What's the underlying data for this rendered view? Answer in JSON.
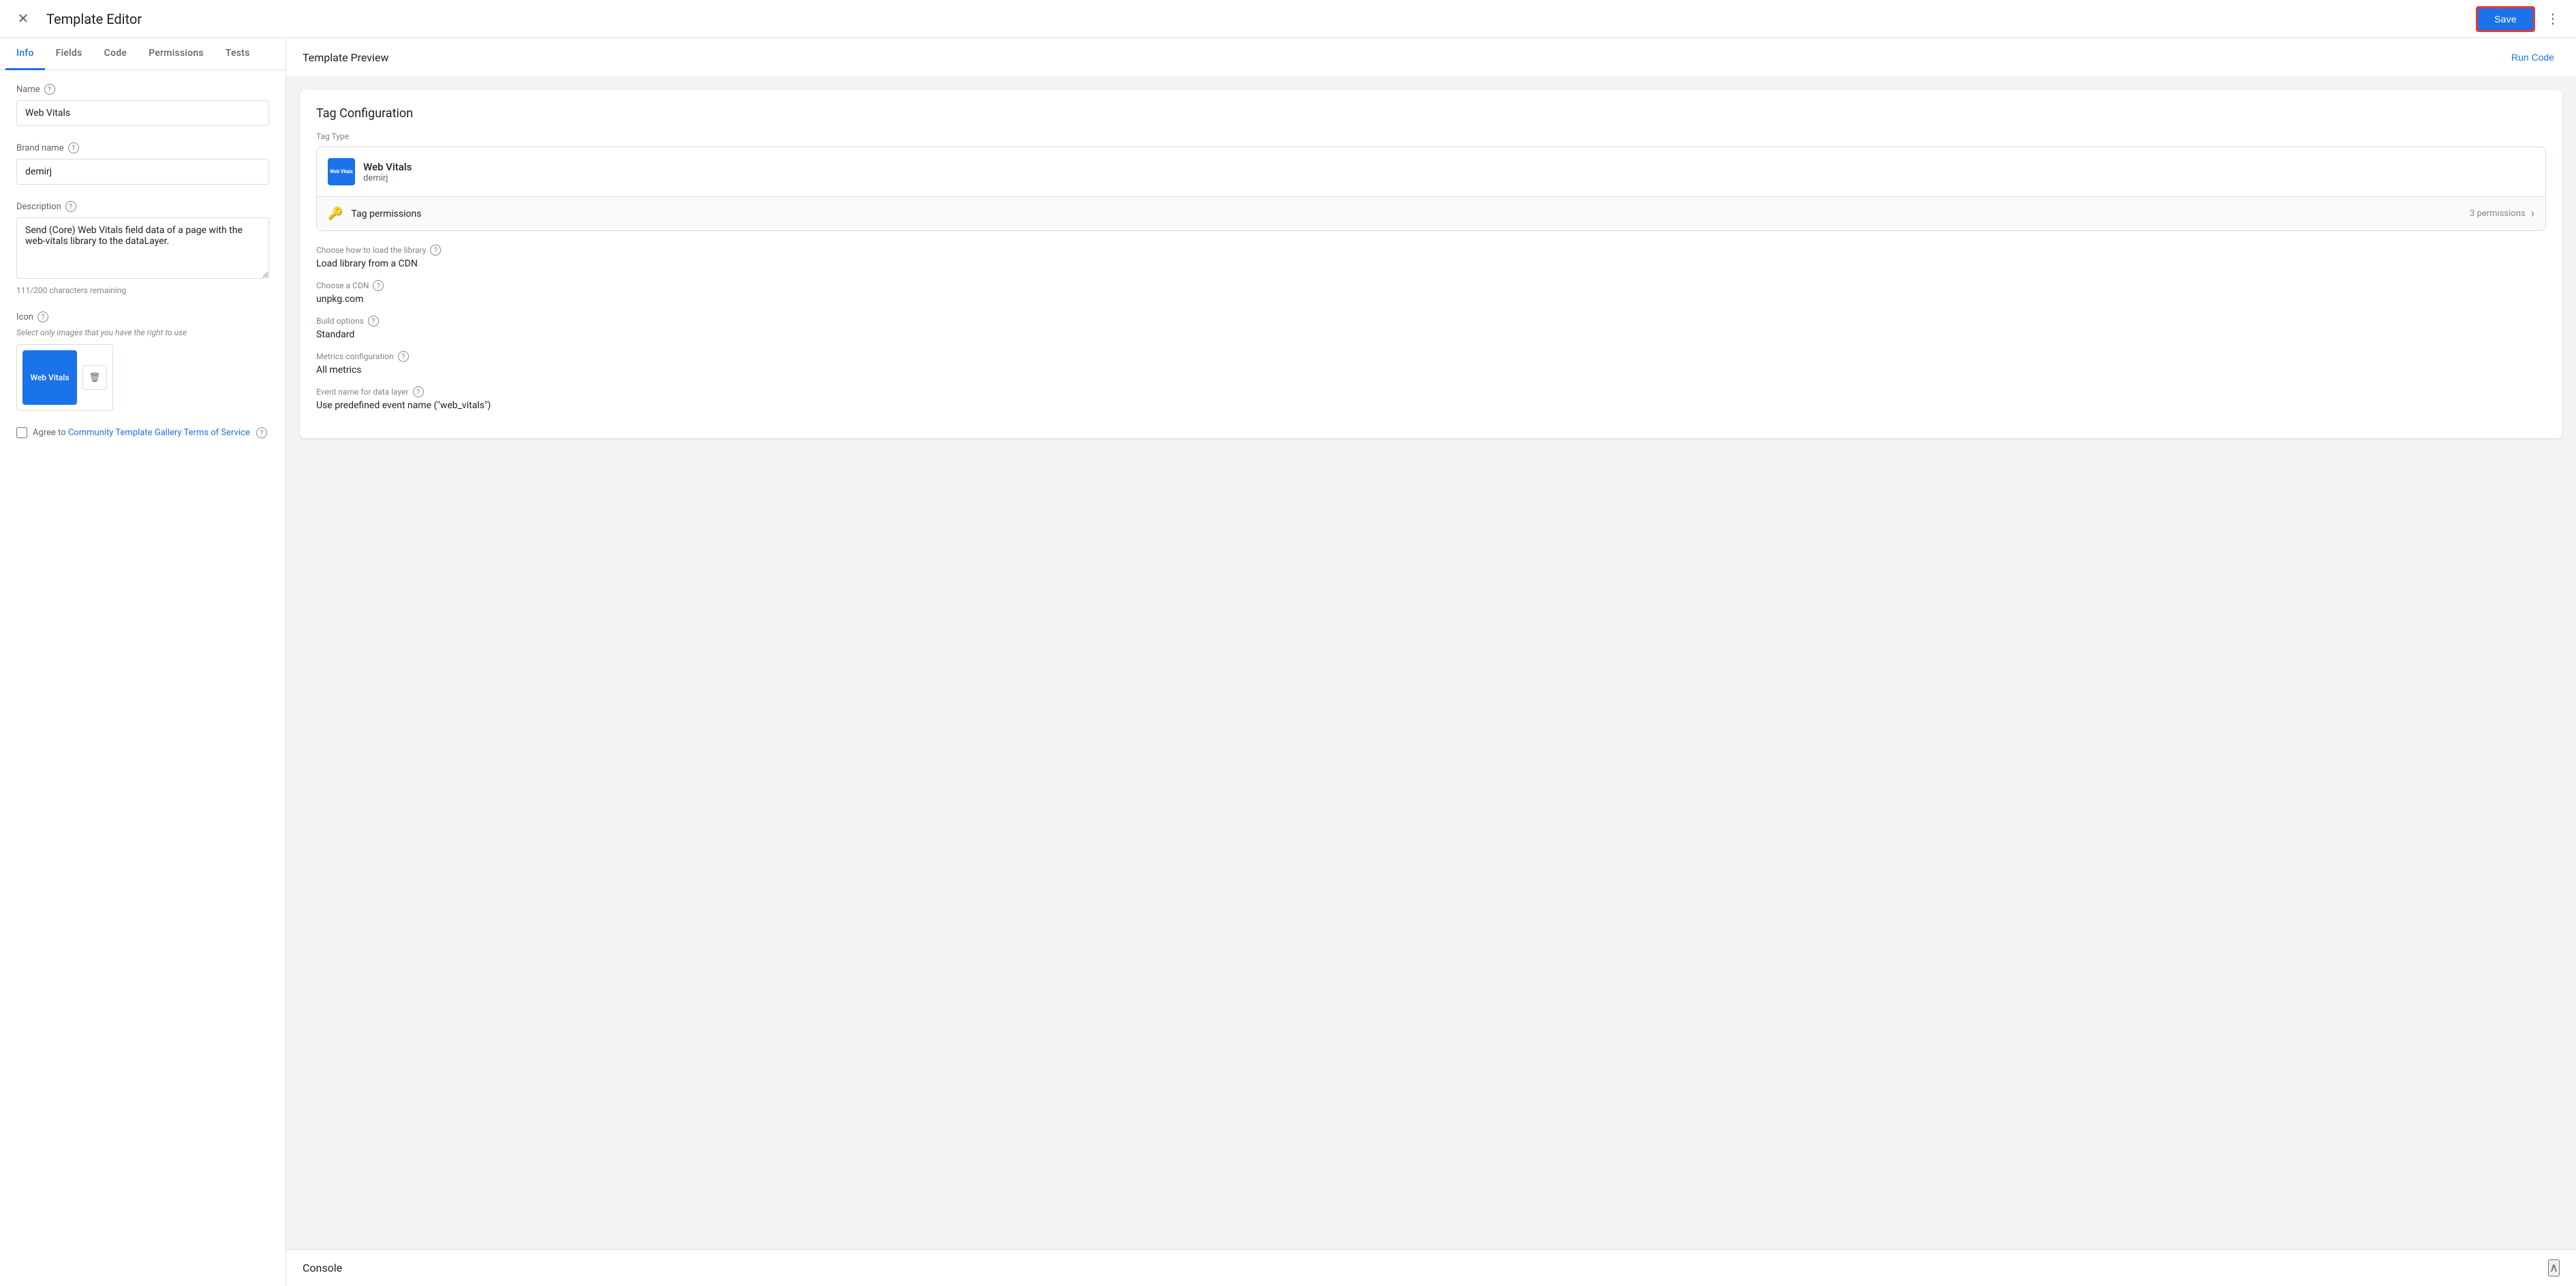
{
  "header": {
    "title": "Template Editor",
    "save_label": "Save",
    "close_icon": "✕",
    "more_icon": "⋮"
  },
  "tabs": [
    {
      "label": "Info",
      "active": true
    },
    {
      "label": "Fields",
      "active": false
    },
    {
      "label": "Code",
      "active": false
    },
    {
      "label": "Permissions",
      "active": false
    },
    {
      "label": "Tests",
      "active": false
    }
  ],
  "form": {
    "name_label": "Name",
    "name_value": "Web Vitals",
    "brand_name_label": "Brand name",
    "brand_name_value": "demirj",
    "description_label": "Description",
    "description_value": "Send (Core) Web Vitals field data of a page with the web-vitals library to the dataLayer.",
    "char_count": "111/200 characters remaining",
    "icon_label": "Icon",
    "icon_hint": "Select only images that you have the right to use",
    "icon_text": "Web Vitals",
    "delete_icon": "🗑"
  },
  "agree": {
    "text": "Agree to ",
    "link_text": "Community Template Gallery Terms of Service"
  },
  "preview": {
    "title": "Template Preview",
    "run_code_label": "Run Code",
    "tag_config_title": "Tag Configuration",
    "tag_type_label": "Tag Type",
    "tag_name": "Web Vitals",
    "tag_author": "demirj",
    "tag_icon_text": "Web Vitals",
    "permissions_label": "Tag permissions",
    "permissions_count": "3 permissions",
    "load_library_label": "Choose how to load the library",
    "load_library_value": "Load library from a CDN",
    "cdn_label": "Choose a CDN",
    "cdn_value": "unpkg.com",
    "build_options_label": "Build options",
    "build_options_value": "Standard",
    "metrics_label": "Metrics configuration",
    "metrics_value": "All metrics",
    "event_name_label": "Event name for data layer",
    "event_name_value": "Use predefined event name (\"web_vitals\")"
  },
  "console": {
    "title": "Console",
    "chevron_icon": "∧"
  },
  "colors": {
    "accent": "#1a73e8",
    "border": "#dadce0",
    "text_secondary": "#5f6368"
  }
}
